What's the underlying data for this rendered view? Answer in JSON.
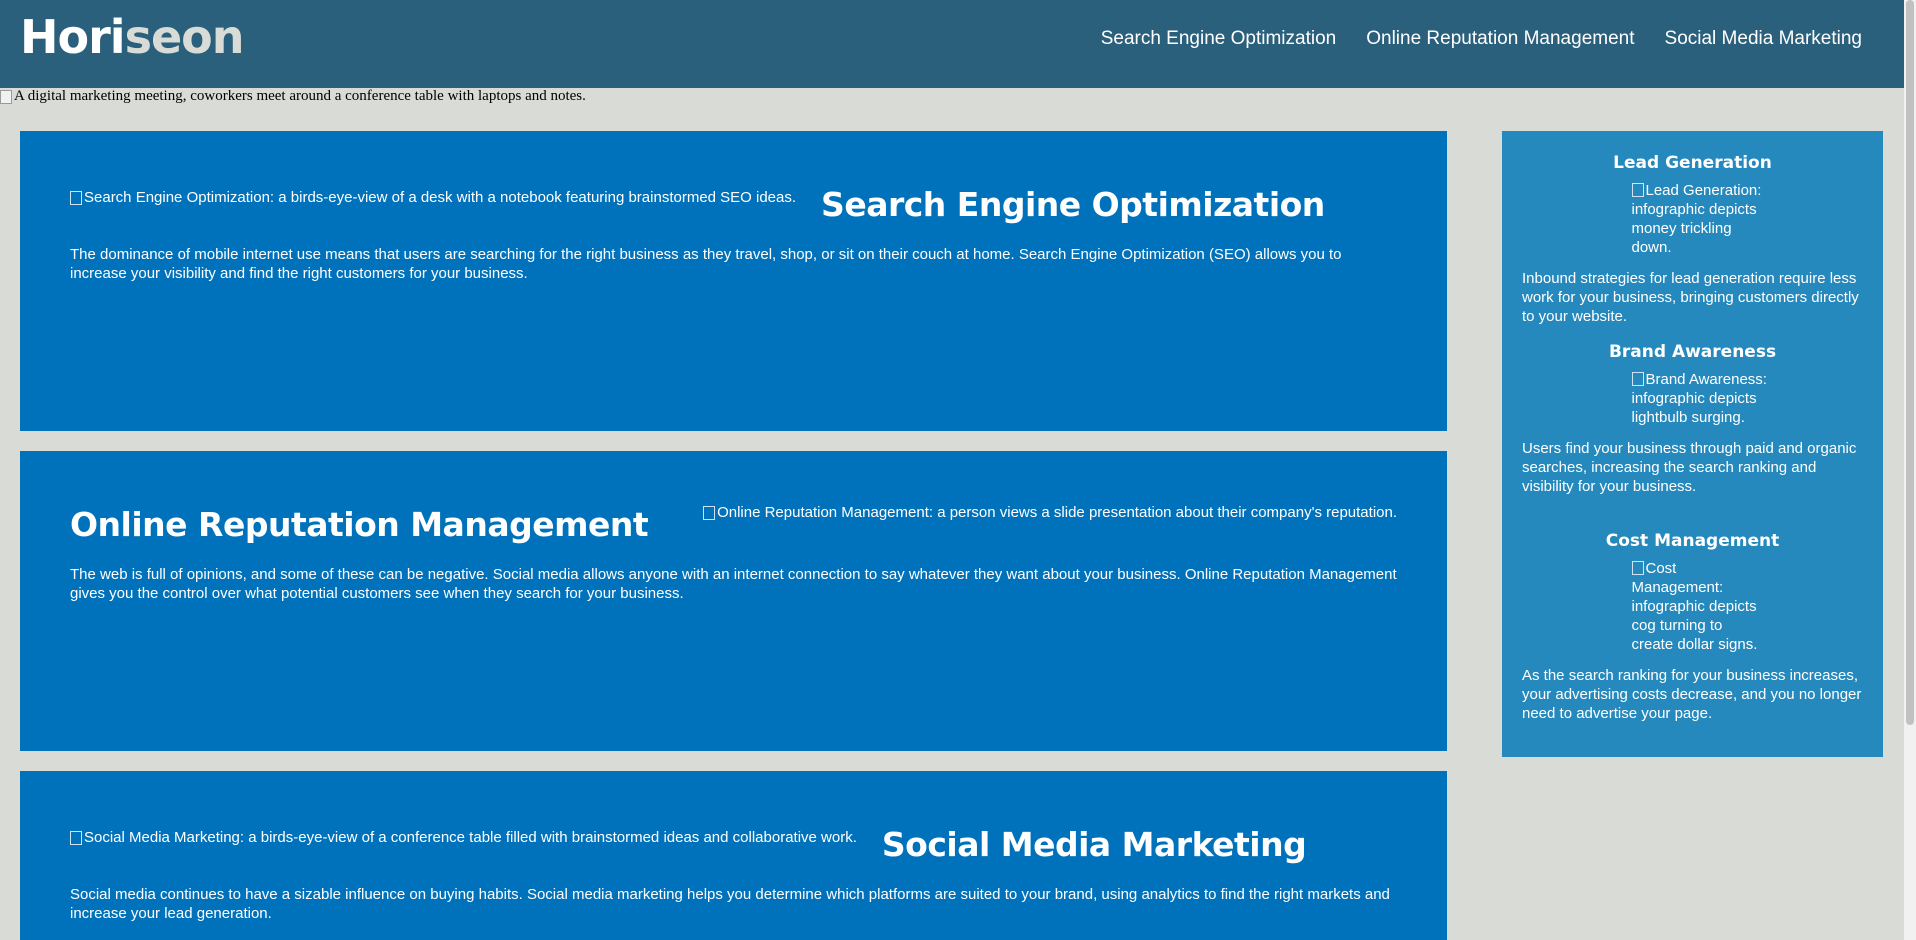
{
  "header": {
    "logo_part1": "Hori",
    "logo_part2": "seon",
    "nav": [
      {
        "label": "Search Engine Optimization"
      },
      {
        "label": "Online Reputation Management"
      },
      {
        "label": "Social Media Marketing"
      }
    ]
  },
  "hero": {
    "alt": "A digital marketing meeting, coworkers meet around a conference table with laptops and notes."
  },
  "sections": [
    {
      "title": "Search Engine Optimization",
      "image_alt": "Search Engine Optimization: a birds-eye-view of a desk with a notebook featuring brainstormed SEO ideas.",
      "text": "The dominance of mobile internet use means that users are searching for the right business as they travel, shop, or sit on their couch at home. Search Engine Optimization (SEO) allows you to increase your visibility and find the right customers for your business."
    },
    {
      "title": "Online Reputation Management",
      "image_alt": "Online Reputation Management: a person views a slide presentation about their company's reputation.",
      "text": "The web is full of opinions, and some of these can be negative. Social media allows anyone with an internet connection to say whatever they want about your business. Online Reputation Management gives you the control over what potential customers see when they search for your business."
    },
    {
      "title": "Social Media Marketing",
      "image_alt": "Social Media Marketing: a birds-eye-view of a conference table filled with brainstormed ideas and collaborative work.",
      "text": "Social media continues to have a sizable influence on buying habits. Social media marketing helps you determine which platforms are suited to your brand, using analytics to find the right markets and increase your lead generation."
    }
  ],
  "benefits": [
    {
      "title": "Lead Generation",
      "image_alt": "Lead Generation: infographic depicts money trickling down.",
      "text": "Inbound strategies for lead generation require less work for your business, bringing customers directly to your website."
    },
    {
      "title": "Brand Awareness",
      "image_alt": "Brand Awareness: infographic depicts lightbulb surging.",
      "text": "Users find your business through paid and organic searches, increasing the search ranking and visibility for your business."
    },
    {
      "title": "Cost Management",
      "image_alt": "Cost Management: infographic depicts cog turning to create dollar signs.",
      "text": "As the search ranking for your business increases, your advertising costs decrease, and you no longer need to advertise your page."
    }
  ],
  "colors": {
    "header_bg": "#2a607c",
    "page_bg": "#d9dcd6",
    "card_bg": "#0072bb",
    "aside_bg": "#2589bd"
  }
}
